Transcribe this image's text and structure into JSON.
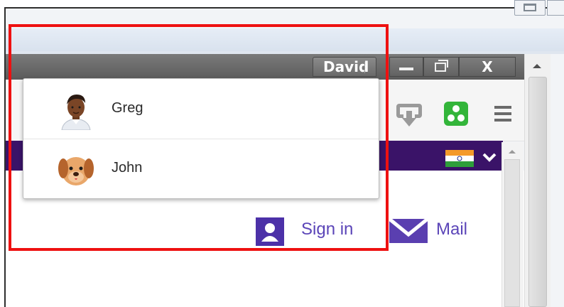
{
  "window": {
    "profile_name": "David",
    "close_glyph": "X",
    "controls": [
      "minimize-icon",
      "restore-icon",
      "close-icon"
    ]
  },
  "profile_menu": {
    "items": [
      {
        "label": "Greg",
        "icon": "avatar-man-icon"
      },
      {
        "label": "John",
        "icon": "avatar-dog-icon"
      }
    ]
  },
  "toolbar": {
    "icons": [
      "download-icon",
      "apps-icon",
      "menu-icon"
    ]
  },
  "banner": {
    "icons": [
      "india-flag-icon",
      "chevron-down-icon"
    ]
  },
  "page": {
    "sign_in_label": "Sign in",
    "mail_label": "Mail"
  },
  "colors": {
    "highlight": "#ee1111",
    "banner": "#3a1368",
    "link": "#5b45b8",
    "apps_green": "#33b53a"
  }
}
